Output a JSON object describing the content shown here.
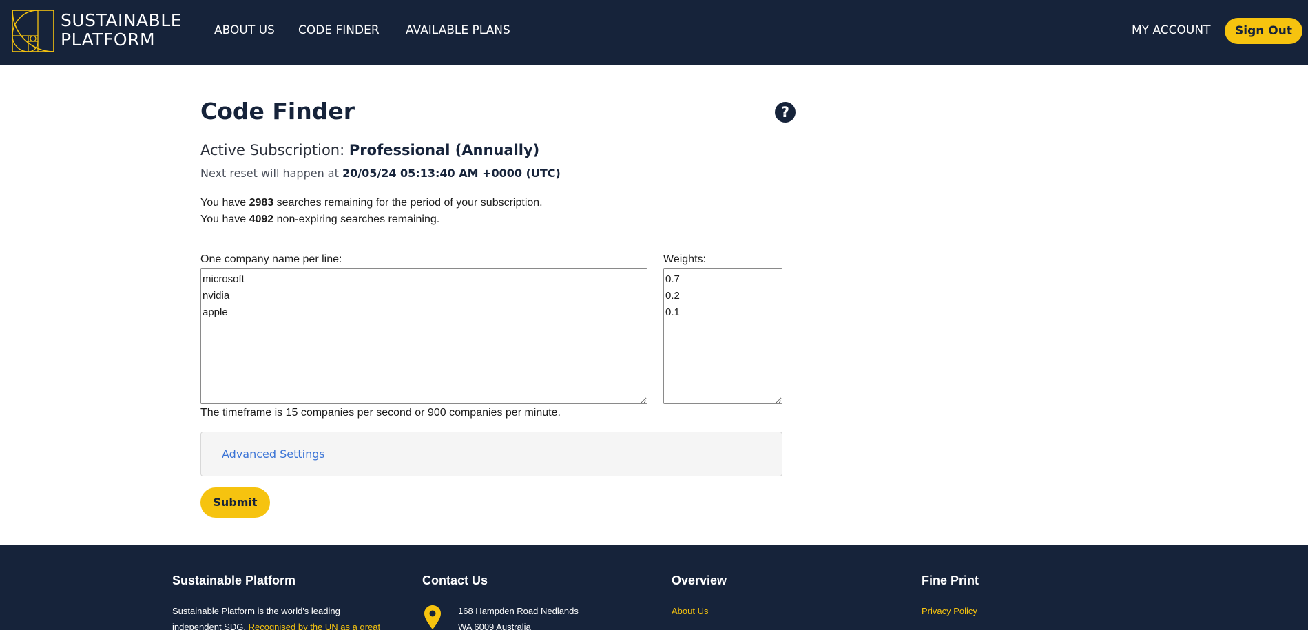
{
  "header": {
    "brand_line1": "SUSTAINABLE",
    "brand_line2": "PLATFORM",
    "nav": {
      "about": "ABOUT US",
      "code_finder": "CODE FINDER",
      "plans": "AVAILABLE PLANS"
    },
    "my_account": "MY ACCOUNT",
    "sign_out": "Sign Out"
  },
  "page": {
    "title": "Code Finder",
    "help_icon": "?",
    "subscription_label": "Active Subscription:",
    "subscription_value": "Professional (Annually)",
    "reset_label": "Next reset will happen at",
    "reset_value": "20/05/24 05:13:40 AM +0000 (UTC)",
    "remaining1_prefix": "You have",
    "remaining1_count": "2983",
    "remaining1_suffix": "searches remaining for the period of your subscription.",
    "remaining2_prefix": "You have",
    "remaining2_count": "4092",
    "remaining2_suffix": "non-expiring searches remaining."
  },
  "form": {
    "companies_label": "One company name per line:",
    "companies_value": "microsoft\nnvidia\napple",
    "weights_label": "Weights:",
    "weights_value": "0.7\n0.2\n0.1",
    "timeframe": "The timeframe is 15 companies per second or 900 companies per minute.",
    "advanced_settings": "Advanced Settings",
    "submit": "Submit"
  },
  "footer": {
    "col1_title": "Sustainable Platform",
    "col1_text_a": "Sustainable Platform is the world's leading",
    "col1_text_b": "independent SDG.",
    "col1_link": "Recognised by the UN as a great",
    "col2_title": "Contact Us",
    "address_line1": "168 Hampden Road Nedlands",
    "address_line2": "WA 6009 Australia",
    "col3_title": "Overview",
    "col3_link": "About Us",
    "col4_title": "Fine Print",
    "col4_link": "Privacy Policy"
  },
  "colors": {
    "navy": "#16233a",
    "accent_yellow": "#f6c30f",
    "link_blue": "#3b74d6"
  },
  "icons": [
    "golden-spiral-logo-icon",
    "question-mark-icon",
    "location-pin-icon"
  ]
}
